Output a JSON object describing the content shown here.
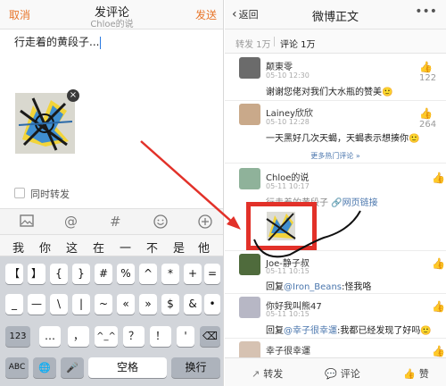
{
  "left": {
    "nav": {
      "cancel": "取消",
      "title": "发评论",
      "subtitle": "Chloe的说",
      "send": "发送"
    },
    "compose_text": "行走着的黄段子...",
    "thumb_close": "×",
    "repost_label": "同时转发",
    "toolbar_icons": [
      "image-icon",
      "at-icon",
      "hashtag-icon",
      "emoji-icon",
      "plus-icon"
    ],
    "candidates": [
      "我",
      "你",
      "这",
      "在",
      "一",
      "不",
      "是",
      "他"
    ],
    "keyboard": {
      "row1": [
        "【",
        "】",
        "{",
        "}",
        "#",
        "%",
        "^",
        "*",
        "+",
        "="
      ],
      "row2": [
        "_",
        "—",
        "\\",
        "|",
        "~",
        "«",
        "»",
        "$",
        "&",
        "•"
      ],
      "row3": [
        "123",
        "…",
        "，",
        "^_^",
        "？",
        "！",
        "'",
        "⌫"
      ],
      "row4": [
        "ABC",
        "🌐",
        "🎤",
        "空格",
        "换行"
      ]
    }
  },
  "right": {
    "nav": {
      "back": "返回",
      "title": "微博正文",
      "more": "•••"
    },
    "tabs": {
      "repost": "转发 1万",
      "comment": "评论 1万"
    },
    "comments": [
      {
        "name": "颠東零",
        "time": "05-10 12:30",
        "text": "谢谢您佬对我们大水瓶的赞美🙂",
        "likes": "122"
      },
      {
        "name": "Lainey欣欣",
        "time": "05-10 12:28",
        "text": "一天黑好几次天蝎，天蝎表示想揍你🙂",
        "likes": "264"
      },
      {
        "name": "Chloe的说",
        "time": "05-11 10:17",
        "text_prefix": "行走着的黄段子",
        "text_link": "网页链接",
        "likes": ""
      },
      {
        "name": "Joe-静子叔",
        "time": "05-11 10:15",
        "reply_prefix": "回复",
        "mention": "@Iron_Beans",
        "text": ":怪我咯",
        "likes": ""
      },
      {
        "name": "你好我叫熊47",
        "time": "05-11 10:15",
        "reply_prefix": "回复",
        "mention": "@幸子很幸運",
        "text": ":我都已经发现了好吗🙂",
        "likes": ""
      },
      {
        "name": "幸子很幸運",
        "time": "",
        "text": "",
        "likes": ""
      }
    ],
    "more_hot": "更多热门评论 »",
    "bottom_bar": {
      "repost": "转发",
      "comment": "评论",
      "like": "赞"
    }
  },
  "colors": {
    "accent": "#e8762b",
    "link": "#4a76ad",
    "annotation_red": "#e23129"
  }
}
